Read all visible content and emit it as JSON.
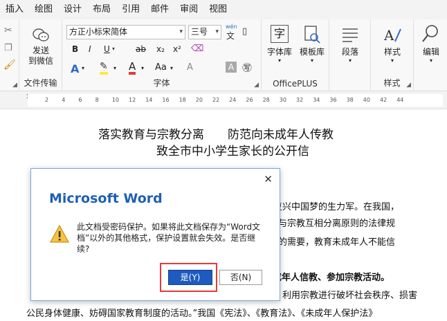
{
  "tabs": [
    "插入",
    "绘图",
    "设计",
    "布局",
    "引用",
    "邮件",
    "审阅",
    "视图"
  ],
  "ribbon": {
    "send_group": {
      "button": "发送\n到微信",
      "label": "文件传输"
    },
    "font_group": {
      "font_name": "方正小标宋简体",
      "font_size": "三号",
      "label": "字体",
      "row2": [
        "B",
        "I",
        "U",
        "ab",
        "x₂",
        "x²"
      ],
      "row3": [
        "A",
        "A",
        "Aa"
      ]
    },
    "officeplus_group": {
      "btn1": "字体库",
      "btn2": "模板库",
      "label": "OfficePLUS"
    },
    "paragraph_btn": "段落",
    "style_group": {
      "btn": "样式",
      "label": "样式"
    },
    "edit_btn": "编辑",
    "phonetic_label": "wén",
    "phonetic_char": "文"
  },
  "ruler": {
    "ticks": [
      "2",
      "4",
      "6",
      "8",
      "10",
      "12",
      "14",
      "16",
      "18",
      "20",
      "22",
      "24",
      "26",
      "28",
      "30",
      "32",
      "34",
      "36",
      "38",
      "40",
      "42",
      "44"
    ]
  },
  "document": {
    "title_line1": "落实教育与宗教分离　　防范向未成年人传教",
    "title_line2": "致全市中小学生家长的公开信",
    "lines": [
      "吕大复兴中国梦的生力军。在我国，",
      "教育与宗教互相分离原则的法律规",
      "成长的需要，教育未成年人不能信",
      "成年人信教、参加宗教活动。",
      "利用宗教进行破坏社会秩序、损害",
      "公民身体健康、妨碍国家教育制度的活动。”我国《宪法》、《教育法》、《未成年人保护法》"
    ]
  },
  "dialog": {
    "title": "Microsoft Word",
    "message": "此文档受密码保护。如果将此文档保存为“Word文档”以外的其他格式，保护设置就会失效。是否继续?",
    "yes_label": "是(Y)",
    "no_label": "否(N)",
    "close_glyph": "✕"
  }
}
